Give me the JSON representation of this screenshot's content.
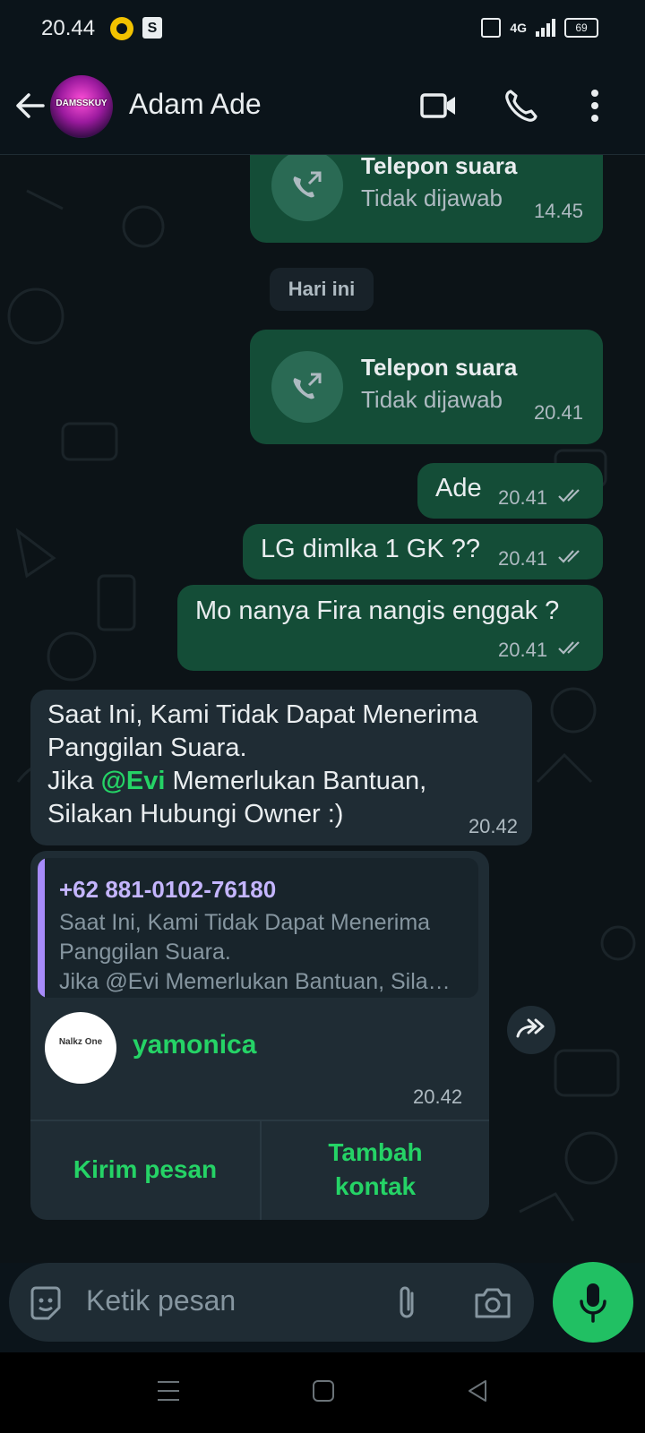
{
  "status": {
    "time": "20.44",
    "shopee_badge": "S",
    "network": "4G",
    "battery": "69"
  },
  "header": {
    "contact_name": "Adam Ade",
    "avatar_text": "DAMSSKUY"
  },
  "messages": {
    "call1": {
      "title": "Telepon suara",
      "subtitle": "Tidak dijawab",
      "time": "14.45"
    },
    "date_chip": "Hari ini",
    "call2": {
      "title": "Telepon suara",
      "subtitle": "Tidak dijawab",
      "time": "20.41"
    },
    "m1": {
      "text": "Ade",
      "time": "20.41"
    },
    "m2": {
      "text": "LG dimlka 1 GK ??",
      "time": "20.41"
    },
    "m3": {
      "text": "Mo nanya Fira nangis enggak ?",
      "time": "20.41"
    },
    "incoming": {
      "line1": "Saat Ini, Kami Tidak Dapat Menerima",
      "line2": "Panggilan Suara.",
      "line3_pre": "Jika ",
      "mention": "@Evi",
      "line3_post": " Memerlukan Bantuan,",
      "line4": "Silakan Hubungi Owner :)",
      "time": "20.42"
    },
    "contact_card": {
      "quote_number": "+62 881-0102-76180",
      "quote_line1": "Saat Ini, Kami Tidak Dapat Menerima",
      "quote_line2": "Panggilan Suara.",
      "quote_line3": "Jika @Evi Memerlukan Bantuan, Sila…",
      "avatar_text": "Nalkz One",
      "name": "yamonica",
      "time": "20.42",
      "send_label": "Kirim pesan",
      "add_label": "Tambah kontak"
    }
  },
  "composer": {
    "placeholder": "Ketik pesan"
  },
  "colors": {
    "accent": "#25d366",
    "outgoing_bubble": "#144d37",
    "incoming_bubble": "#1f2c34",
    "background": "#0b141a"
  }
}
